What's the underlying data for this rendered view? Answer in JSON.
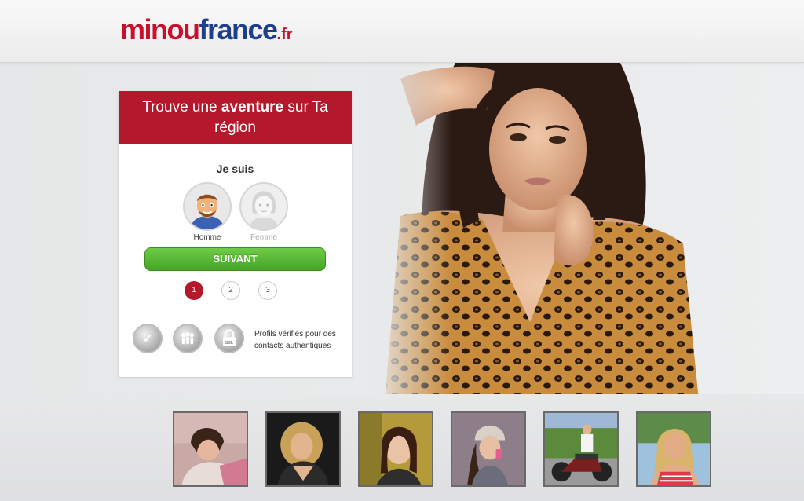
{
  "header": {
    "logo_minou": "minou",
    "logo_france": "france",
    "logo_tld": ".fr"
  },
  "card": {
    "title_pre": "Trouve une ",
    "title_bold": "aventure",
    "title_post": " sur Ta région",
    "je_suis": "Je suis",
    "gender_man": "Homme",
    "gender_woman": "Femme",
    "next_button": "SUIVANT",
    "steps": [
      "1",
      "2",
      "3"
    ],
    "current_step": 1,
    "badges_text": "Profils vérifiés pour des contacts authentiques"
  },
  "colors": {
    "brand_red": "#b5172b",
    "logo_blue": "#1e3f8a",
    "button_green": "#45a526"
  },
  "icons": {
    "badge_1": "checkmark-seal-icon",
    "badge_2": "people-seal-icon",
    "badge_3": "ssl-lock-icon"
  }
}
